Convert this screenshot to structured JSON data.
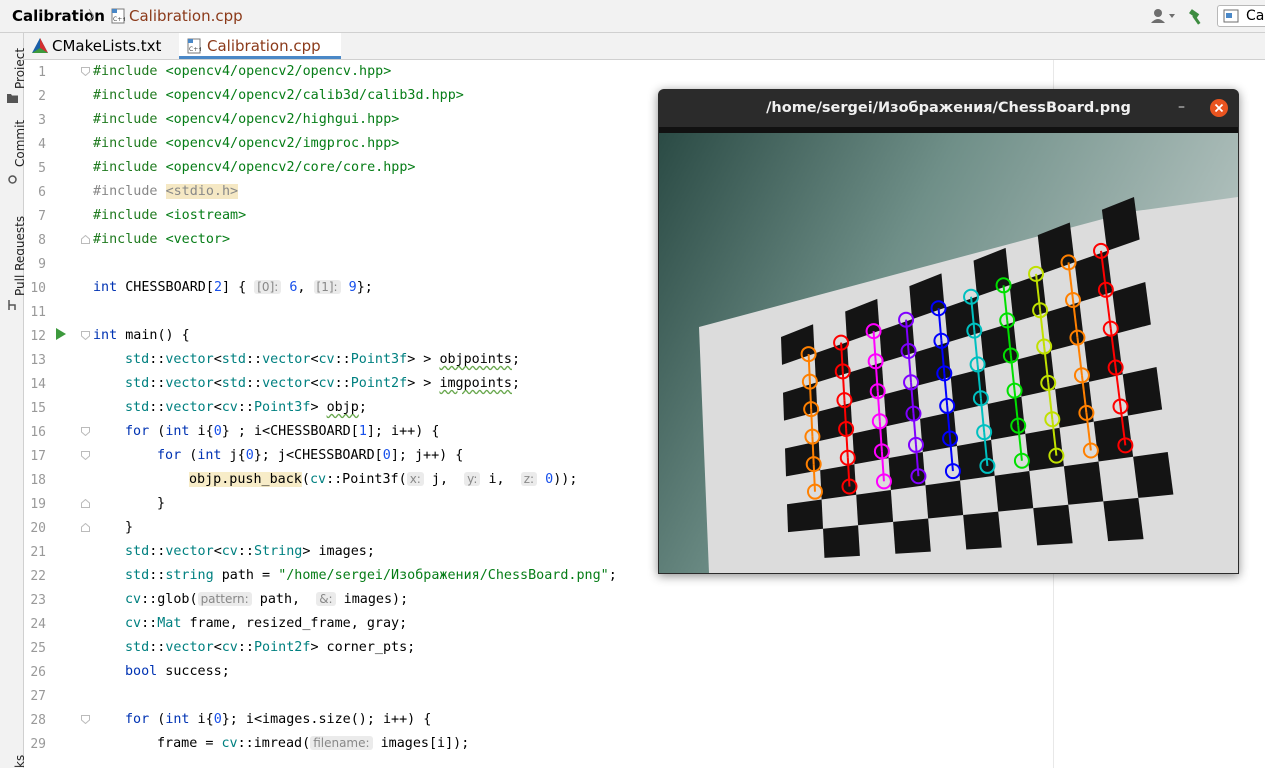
{
  "breadcrumb": {
    "project": "Calibration",
    "separator": "〉",
    "file": "Calibration.cpp"
  },
  "toolbar": {
    "run_config_label": "Ca"
  },
  "left_tools": [
    {
      "label": "Project",
      "icon": "folder-icon"
    },
    {
      "label": "Commit",
      "icon": "commit-icon"
    },
    {
      "label": "Pull Requests",
      "icon": "pull-request-icon"
    },
    {
      "label": "ks",
      "icon": ""
    }
  ],
  "tabs": [
    {
      "label": "CMakeLists.txt",
      "icon": "cmake-icon",
      "active": false
    },
    {
      "label": "Calibration.cpp",
      "icon": "cpp-file-icon",
      "active": true
    }
  ],
  "line_numbers": [
    "1",
    "2",
    "3",
    "4",
    "5",
    "6",
    "7",
    "8",
    "9",
    "10",
    "11",
    "12",
    "13",
    "14",
    "15",
    "16",
    "17",
    "18",
    "19",
    "20",
    "21",
    "22",
    "23",
    "24",
    "25",
    "26",
    "27",
    "28",
    "29"
  ],
  "code": {
    "inc1_kw": "#include",
    "inc1_path": "<opencv4/opencv2/opencv.hpp>",
    "inc2_kw": "#include",
    "inc2_path": "<opencv4/opencv2/calib3d/calib3d.hpp>",
    "inc3_kw": "#include",
    "inc3_path": "<opencv4/opencv2/highgui.hpp>",
    "inc4_kw": "#include",
    "inc4_path": "<opencv4/opencv2/imgproc.hpp>",
    "inc5_kw": "#include",
    "inc5_path": "<opencv4/opencv2/core/core.hpp>",
    "inc6_kw": "#include",
    "inc6_path": "<stdio.h>",
    "inc7_kw": "#include",
    "inc7_path": "<iostream>",
    "inc8_kw": "#include",
    "inc8_path": "<vector>",
    "l10_kw": "int",
    "l10_a": " CHESSBOARD[",
    "l10_n2": "2",
    "l10_b": "] { ",
    "l10_h0": "[0]:",
    "l10_n6": " 6",
    "l10_c": ", ",
    "l10_h1": "[1]:",
    "l10_n9": " 9",
    "l10_d": "};",
    "l12_kw": "int",
    "l12_rest": " main() {",
    "l13_ns1": "std",
    "l13_a": "::",
    "l13_t1": "vector",
    "l13_b": "<",
    "l13_ns2": "std",
    "l13_c": "::",
    "l13_t2": "vector",
    "l13_d": "<",
    "l13_ns3": "cv",
    "l13_e": "::",
    "l13_t3": "Point3f",
    "l13_f": "> > ",
    "l13_var": "objpoints",
    "l13_g": ";",
    "l14_ns1": "std",
    "l14_a": "::",
    "l14_t1": "vector",
    "l14_b": "<",
    "l14_ns2": "std",
    "l14_c": "::",
    "l14_t2": "vector",
    "l14_d": "<",
    "l14_ns3": "cv",
    "l14_e": "::",
    "l14_t3": "Point2f",
    "l14_f": "> > ",
    "l14_var": "imgpoints",
    "l14_g": ";",
    "l15_ns1": "std",
    "l15_a": "::",
    "l15_t1": "vector",
    "l15_b": "<",
    "l15_ns2": "cv",
    "l15_c": "::",
    "l15_t2": "Point3f",
    "l15_d": "> ",
    "l15_var": "objp",
    "l15_e": ";",
    "l16_kw": "for",
    "l16_a": " (",
    "l16_kw2": "int",
    "l16_b": " i{",
    "l16_n": "0",
    "l16_c": "} ; i<CHESSBOARD[",
    "l16_n1": "1",
    "l16_d": "]; i++) {",
    "l17_kw": "for",
    "l17_a": " (",
    "l17_kw2": "int",
    "l17_b": " j{",
    "l17_n": "0",
    "l17_c": "}; j<CHESSBOARD[",
    "l17_n0": "0",
    "l17_d": "]; j++) {",
    "l18_fn": "objp.push_back",
    "l18_a": "(",
    "l18_ns": "cv",
    "l18_b": "::Point3f(",
    "l18_hx": "x:",
    "l18_c": " j,  ",
    "l18_hy": "y:",
    "l18_d": " i,  ",
    "l18_hz": "z:",
    "l18_n": " 0",
    "l18_e": "));",
    "l19": "}",
    "l20": "}",
    "l21_ns1": "std",
    "l21_a": "::",
    "l21_t1": "vector",
    "l21_b": "<",
    "l21_ns2": "cv",
    "l21_c": "::",
    "l21_t2": "String",
    "l21_d": "> images;",
    "l22_ns": "std",
    "l22_a": "::",
    "l22_t": "string",
    "l22_b": " path = ",
    "l22_str": "\"/home/sergei/Изображения/ChessBoard.png\"",
    "l22_c": ";",
    "l23_ns": "cv",
    "l23_a": "::glob(",
    "l23_h1": "pattern:",
    "l23_b": " path,  ",
    "l23_h2": "&:",
    "l23_c": " images);",
    "l24_ns": "cv",
    "l24_a": "::",
    "l24_t": "Mat",
    "l24_b": " frame, resized_frame, gray;",
    "l25_ns1": "std",
    "l25_a": "::",
    "l25_t1": "vector",
    "l25_b": "<",
    "l25_ns2": "cv",
    "l25_c": "::",
    "l25_t2": "Point2f",
    "l25_d": "> corner_pts;",
    "l26_kw": "bool",
    "l26_rest": " success;",
    "l28_kw": "for",
    "l28_a": " (",
    "l28_kw2": "int",
    "l28_b": " i{",
    "l28_n": "0",
    "l28_c": "}; i<images.size(); i++) {",
    "l29_a": "frame = ",
    "l29_ns": "cv",
    "l29_b": "::imread(",
    "l29_h": "filename:",
    "l29_c": " images[i]);"
  },
  "image_window": {
    "title": "/home/sergei/Изображения/ChessBoard.png",
    "minimize": "–",
    "close_icon": "close-icon"
  },
  "colors": {
    "keyword": "#0033b3",
    "preprocessor_path": "#1f7a1f",
    "number": "#1750eb",
    "namespace": "#008080",
    "string": "#067d17",
    "window_title_bg": "#2b2b2b",
    "close_button": "#e95420"
  },
  "chessboard_corner_colors": [
    "#ff8000",
    "#ff0000",
    "#ff00ff",
    "#8000ff",
    "#0000ff",
    "#00c0c0",
    "#00e000",
    "#c0e000",
    "#ff8000",
    "#ff0000"
  ]
}
